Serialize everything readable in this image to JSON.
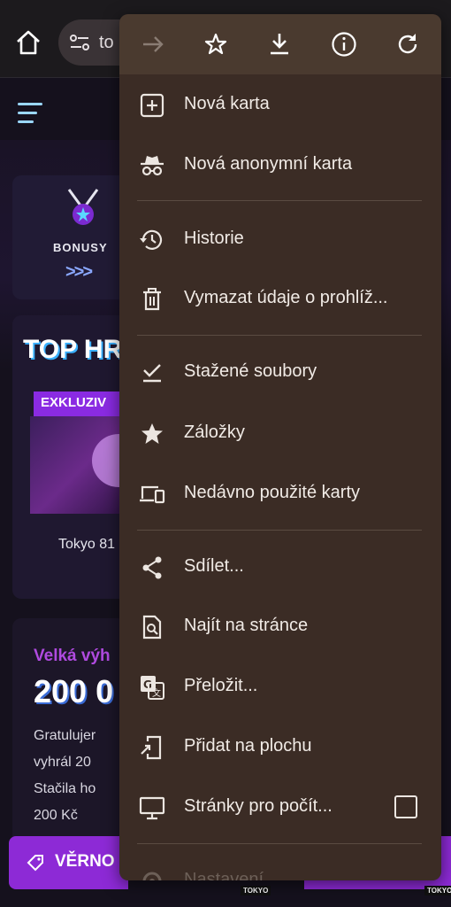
{
  "browser": {
    "url_partial": "to"
  },
  "site": {
    "bonus_label": "BONUSY",
    "bonus_arrows": ">>>",
    "top_title": "TOP HR",
    "exclusive_badge": "EXKLUZIV",
    "game_caption": "Tokyo 81",
    "win_title": "Velká výh",
    "win_amount": "200 0",
    "win_text_lines": [
      "Gratulujer",
      "vyhrál 20",
      "Stačila ho",
      "200 Kč"
    ],
    "loyalty_label": "VĚRNO",
    "right_strip_text": "S",
    "tokyo_tag": "TOKYO"
  },
  "menu": {
    "items": [
      {
        "label": "Nová karta",
        "icon": "new-tab-icon"
      },
      {
        "label": "Nová anonymní karta",
        "icon": "incognito-icon"
      },
      {
        "label": "Historie",
        "icon": "history-icon"
      },
      {
        "label": "Vymazat údaje o prohlíž...",
        "icon": "trash-icon"
      },
      {
        "label": "Stažené soubory",
        "icon": "downloads-check-icon"
      },
      {
        "label": "Záložky",
        "icon": "star-filled-icon"
      },
      {
        "label": "Nedávno použité karty",
        "icon": "devices-icon"
      },
      {
        "label": "Sdílet...",
        "icon": "share-icon"
      },
      {
        "label": "Najít na stránce",
        "icon": "find-in-page-icon"
      },
      {
        "label": "Přeložit...",
        "icon": "translate-icon"
      },
      {
        "label": "Přidat na plochu",
        "icon": "add-to-home-icon"
      },
      {
        "label": "Stránky pro počít...",
        "icon": "desktop-icon",
        "checked": false
      },
      {
        "label": "Nastavení",
        "icon": "settings-icon",
        "disabled": true
      }
    ]
  },
  "colors": {
    "menu_bg": "#3b2c25",
    "menu_toolbar_bg": "#4a3a2f",
    "accent_purple": "#8d2ad6"
  }
}
